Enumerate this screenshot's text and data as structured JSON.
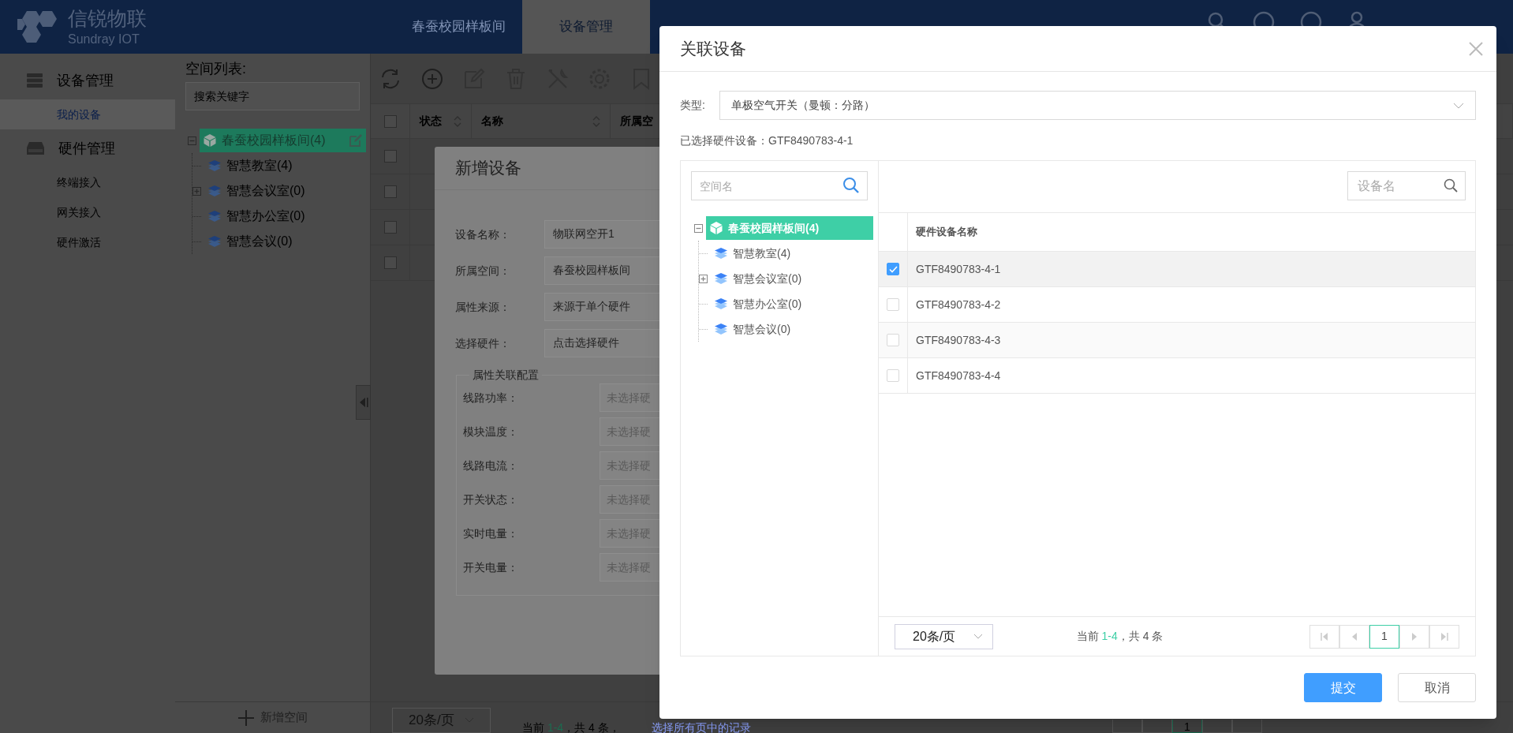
{
  "header": {
    "logo_title": "信锐物联",
    "logo_subtitle": "Sundray IOT",
    "nav": [
      {
        "label": "春蚕校园样板间",
        "selected": false
      },
      {
        "label": "设备管理",
        "selected": true
      }
    ]
  },
  "sidebar": {
    "groups": [
      {
        "label": "设备管理",
        "kind": "device",
        "items": [
          {
            "label": "我的设备",
            "selected": true
          }
        ]
      },
      {
        "label": "硬件管理",
        "kind": "hardware",
        "items": [
          {
            "label": "终端接入",
            "selected": false
          },
          {
            "label": "网关接入",
            "selected": false
          },
          {
            "label": "硬件激活",
            "selected": false
          }
        ]
      }
    ]
  },
  "space_panel": {
    "title": "空间列表:",
    "search_placeholder": "搜索关键字",
    "tree": [
      {
        "label": "春蚕校园样板间(4)",
        "selected": true,
        "expanded": true,
        "editable": true,
        "children": [
          {
            "label": "智慧教室(4)",
            "selected": false
          },
          {
            "label": "智慧会议室(0)",
            "selected": false,
            "expanded": false
          },
          {
            "label": "智慧办公室(0)",
            "selected": false
          },
          {
            "label": "智慧会议(0)",
            "selected": false
          }
        ]
      }
    ],
    "add_button": "新增空间"
  },
  "device_table": {
    "columns": [
      {
        "label": "状态",
        "sortable": true
      },
      {
        "label": "名称",
        "sortable": true
      },
      {
        "label": "所属空",
        "sortable": false
      }
    ],
    "header_checked": false,
    "rows": [
      {
        "checked": false
      },
      {
        "checked": false
      },
      {
        "checked": false
      },
      {
        "checked": false
      }
    ],
    "page_size": "20条/页",
    "summary_prefix": "当前 ",
    "range": "1-4",
    "summary_suffix": "，共 4 条，",
    "select_all_link": "选择所有页中的记录",
    "page": "1"
  },
  "add_device_dialog": {
    "title": "新增设备",
    "fields": [
      {
        "label": "设备名称：",
        "value": "物联网空开1"
      },
      {
        "label": "所属空间：",
        "value": "春蚕校园样板间"
      },
      {
        "label": "属性来源：",
        "value": "来源于单个硬件"
      },
      {
        "label": "选择硬件：",
        "value": "点击选择硬件"
      }
    ],
    "fieldset": {
      "legend": "属性关联配置",
      "rows": [
        {
          "label": "线路功率：",
          "placeholder": "未选择硬"
        },
        {
          "label": "模块温度：",
          "placeholder": "未选择硬"
        },
        {
          "label": "线路电流：",
          "placeholder": "未选择硬"
        },
        {
          "label": "开关状态：",
          "placeholder": "未选择硬"
        },
        {
          "label": "实时电量：",
          "placeholder": "未选择硬"
        },
        {
          "label": "开关电量：",
          "placeholder": "未选择硬"
        }
      ]
    }
  },
  "relate_dialog": {
    "title": "关联设备",
    "type_label": "类型:",
    "type_value": "单极空气开关（曼顿：分路）",
    "selected_text": "已选择硬件设备：GTF8490783-4-1",
    "space_search_placeholder": "空间名",
    "tree": [
      {
        "label": "春蚕校园样板间(4)",
        "selected": true,
        "expanded": true,
        "children": [
          {
            "label": "智慧教室(4)",
            "selected": false
          },
          {
            "label": "智慧会议室(0)",
            "selected": false,
            "expanded": false
          },
          {
            "label": "智慧办公室(0)",
            "selected": false
          },
          {
            "label": "智慧会议(0)",
            "selected": false
          }
        ]
      }
    ],
    "device_search_placeholder": "设备名",
    "column": "硬件设备名称",
    "rows": [
      {
        "name": "GTF8490783-4-1",
        "checked": true
      },
      {
        "name": "GTF8490783-4-2",
        "checked": false
      },
      {
        "name": "GTF8490783-4-3",
        "checked": false
      },
      {
        "name": "GTF8490783-4-4",
        "checked": false
      }
    ],
    "page_size": "20条/页",
    "summary_prefix": "当前 ",
    "range": "1-4",
    "summary_suffix": "，共 4 条",
    "page": "1",
    "buttons": [
      {
        "label": "提交",
        "kind": "primary"
      },
      {
        "label": "取消",
        "kind": "default"
      }
    ]
  }
}
